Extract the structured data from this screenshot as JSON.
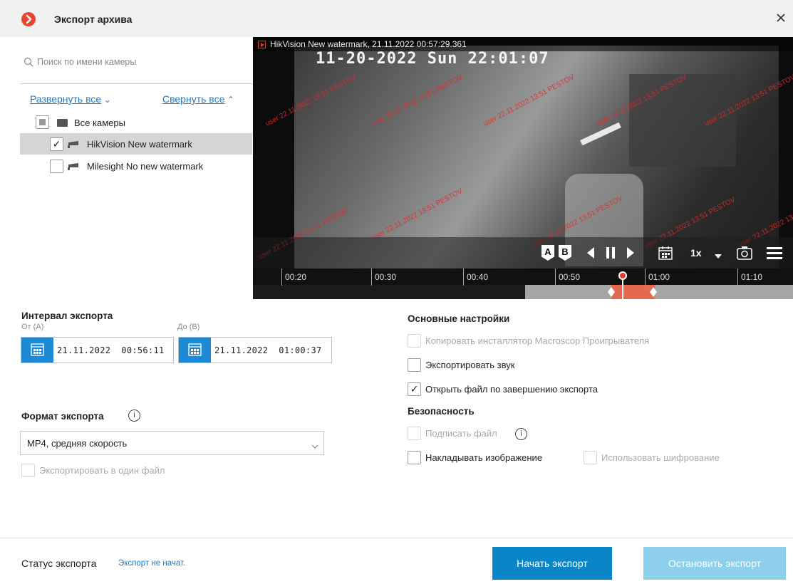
{
  "window": {
    "title": "Экспорт архива"
  },
  "search": {
    "placeholder": "Поиск по имени камеры"
  },
  "tree": {
    "expand_all": "Развернуть все",
    "collapse_all": "Свернуть все",
    "items": [
      {
        "label": "Все камеры",
        "state": "partial"
      },
      {
        "label": "HikVision New watermark",
        "state": "checked",
        "selected": true
      },
      {
        "label": "Milesight No new watermark",
        "state": "unchecked"
      }
    ]
  },
  "video": {
    "label": "HikVision New watermark, 21.11.2022 00:57:29.361",
    "osd_time": "11-20-2022 Sun 22:01:07",
    "watermark": "user 22.11.2022 13:51 PESTOV",
    "controls": {
      "marker_a": "A",
      "marker_b": "B",
      "speed": "1x"
    }
  },
  "timeline": {
    "ticks": [
      "00:20",
      "00:30",
      "00:40",
      "00:50",
      "01:00",
      "01:10"
    ]
  },
  "interval": {
    "title": "Интервал экспорта",
    "from_label": "От (A)",
    "to_label": "До (B)",
    "from_value": "21.11.2022  00:56:11",
    "to_value": "21.11.2022  01:00:37"
  },
  "format": {
    "title": "Формат экспорта",
    "info": "i",
    "selected": "MP4, средняя скорость",
    "single_file_label": "Экспортировать в один файл"
  },
  "settings": {
    "title": "Основные настройки",
    "copy_installer": "Копировать инсталлятор Macroscop Проигрывателя",
    "export_sound": "Экспортировать звук",
    "open_file": "Открыть файл по завершению экспорта"
  },
  "security": {
    "title": "Безопасность",
    "sign_file": "Подписать файл",
    "info": "i",
    "overlay_image": "Накладывать изображение",
    "use_encryption": "Использовать шифрование"
  },
  "footer": {
    "status_label": "Статус экспорта",
    "status_value": "Экспорт не начат.",
    "start_button": "Начать экспорт",
    "stop_button": "Остановить экспорт"
  },
  "colors": {
    "accent": "#1e8ad3",
    "brand": "#e8442f",
    "link": "#1e7ac8",
    "start_button": "#0a86c8",
    "stop_button": "#8ecfeb"
  }
}
